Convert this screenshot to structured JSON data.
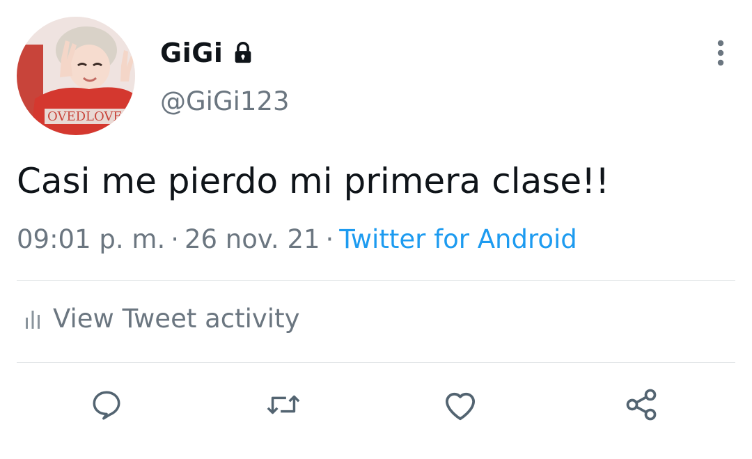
{
  "author": {
    "display_name": "GiGi",
    "username": "@GiGi123",
    "protected_icon": "lock-icon",
    "avatar_icon": "profile-photo"
  },
  "tweet": {
    "text": "Casi me pierdo mi primera clase!!",
    "time": "09:01 p. m.",
    "separator": "·",
    "date": "26 nov. 21",
    "source": "Twitter for Android"
  },
  "activity": {
    "label": "View Tweet activity",
    "icon": "bar-chart-icon"
  },
  "actions": [
    {
      "name": "reply",
      "icon": "reply-icon"
    },
    {
      "name": "retweet",
      "icon": "retweet-icon"
    },
    {
      "name": "like",
      "icon": "heart-icon"
    },
    {
      "name": "share",
      "icon": "share-icon"
    }
  ],
  "colors": {
    "text_primary": "#0f1419",
    "text_secondary": "#6b7680",
    "link": "#1d9bf0",
    "divider": "#e3e6e8",
    "icon": "#536471"
  }
}
